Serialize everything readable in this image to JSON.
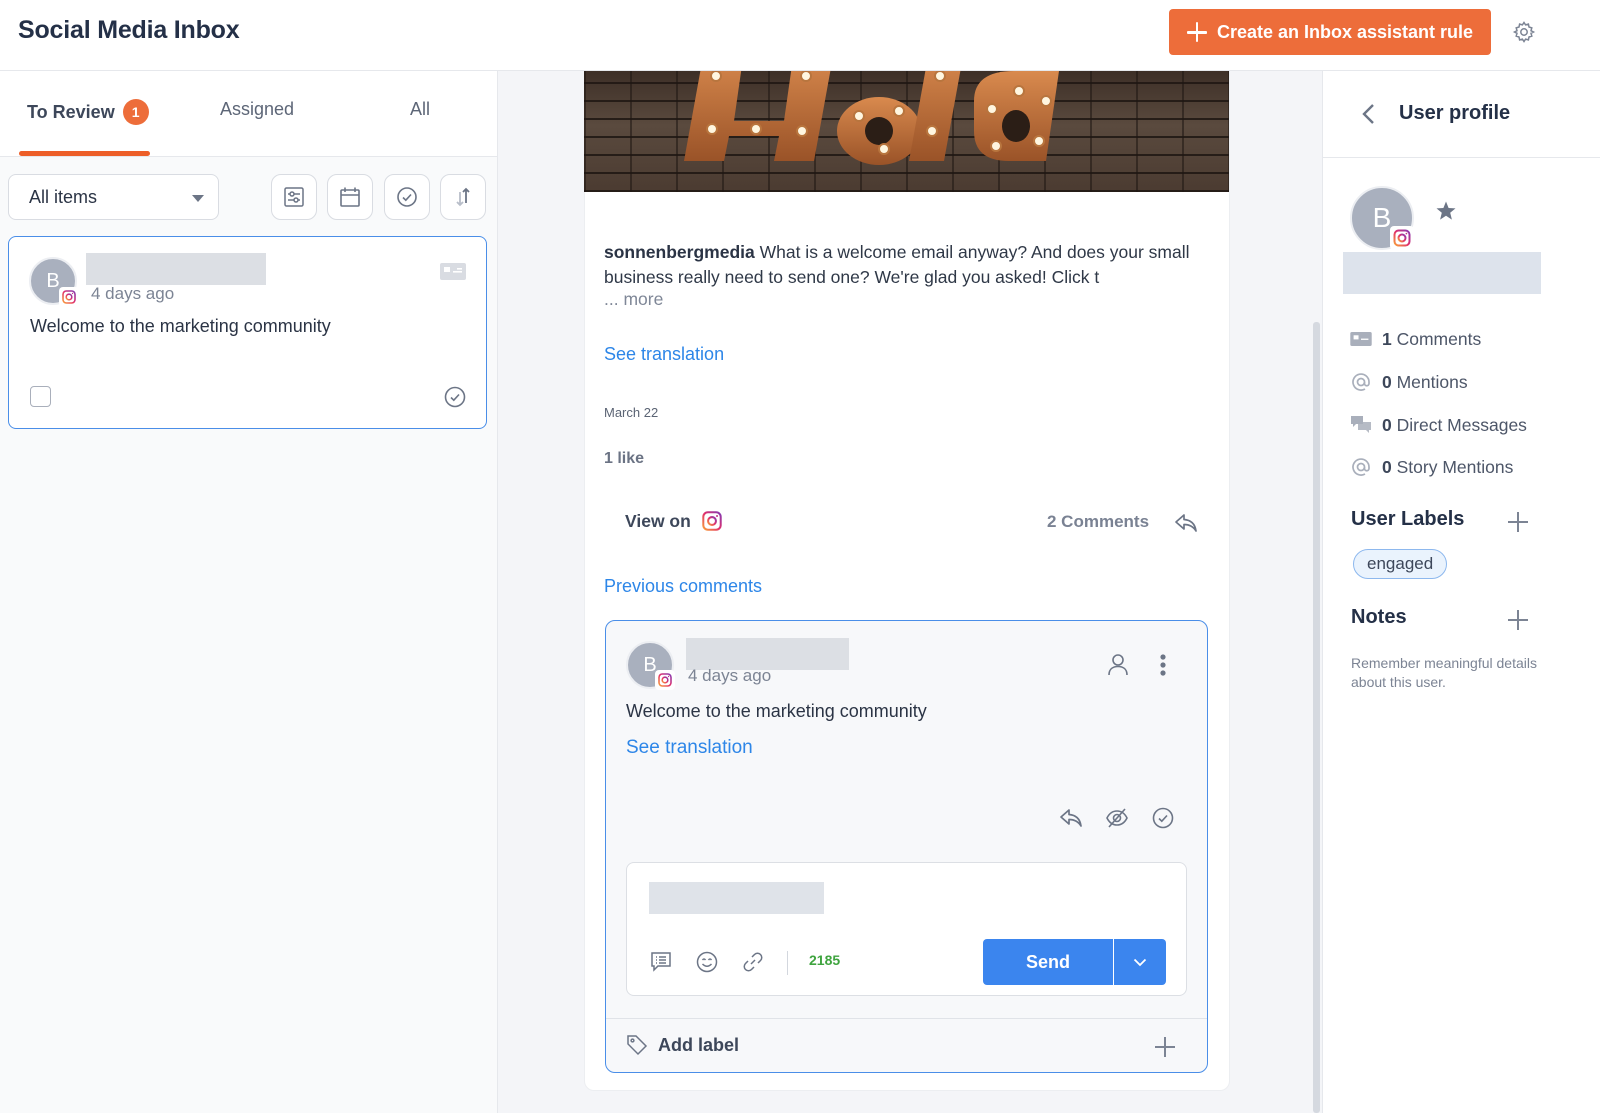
{
  "header": {
    "title": "Social Media Inbox",
    "create_rule_label": "Create an Inbox assistant rule",
    "settings_icon": "gear-icon"
  },
  "left": {
    "tabs": [
      {
        "label": "To Review",
        "badge": "1",
        "active": true
      },
      {
        "label": "Assigned",
        "active": false
      },
      {
        "label": "All",
        "active": false
      }
    ],
    "filter": {
      "selected": "All items",
      "buttons": [
        "filter-sliders-icon",
        "calendar-icon",
        "check-circle-icon",
        "sort-icon"
      ]
    },
    "items": [
      {
        "avatar_initial": "B",
        "platform": "instagram",
        "time_ago": "4 days ago",
        "message": "Welcome to the marketing community",
        "type_icon": "comment-card-icon"
      }
    ]
  },
  "post": {
    "author": "sonnenbergmedia",
    "caption": " What is a welcome email anyway? And does your small business really need to send one? We're glad you asked! Click t",
    "more_label": "... more",
    "see_translation": "See translation",
    "date": "March 22",
    "likes": "1 like",
    "view_on_label": "View on",
    "comments_count": "2 Comments",
    "previous_comments": "Previous comments"
  },
  "comment": {
    "avatar_initial": "B",
    "time_ago": "4 days ago",
    "message": "Welcome to the marketing community",
    "see_translation": "See translation",
    "reply_box": {
      "char_count": "2185",
      "send_label": "Send"
    },
    "add_label": "Add label"
  },
  "profile": {
    "title": "User profile",
    "avatar_initial": "B",
    "stats": [
      {
        "count": "1",
        "label": "Comments",
        "icon": "comment-card-icon"
      },
      {
        "count": "0",
        "label": "Mentions",
        "icon": "at-icon"
      },
      {
        "count": "0",
        "label": "Direct Messages",
        "icon": "chat-bubbles-icon"
      },
      {
        "count": "0",
        "label": "Story Mentions",
        "icon": "at-icon"
      }
    ],
    "user_labels_title": "User Labels",
    "labels": [
      "engaged"
    ],
    "notes_title": "Notes",
    "notes_hint": "Remember meaningful details about this user."
  },
  "colors": {
    "accent": "#ed6d3a",
    "link": "#2d86e8",
    "primary_button": "#3b85ee",
    "selected_border": "#4a8ee8",
    "char_count": "#3fa43f"
  }
}
